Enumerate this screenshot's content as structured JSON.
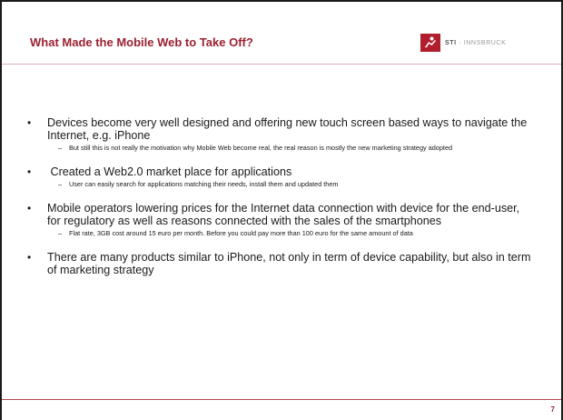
{
  "slide": {
    "title": "What Made the Mobile Web to Take Off?",
    "logo": {
      "mark": "sti-logo-icon",
      "text_bold": "STI",
      "text_rest": " · INNSBRUCK"
    },
    "bullets": [
      {
        "text": "Devices become very well designed and offering new touch screen based ways to navigate the Internet, e.g. iPhone",
        "sub": "But still this is not really the motivation why Mobile Web become real, the real reason is mostly the new marketing strategy adopted"
      },
      {
        "text": " Created a Web2.0 market place for applications",
        "sub": "User can easily search for applications matching their needs, install them and updated them"
      },
      {
        "text": "Mobile operators lowering prices for the Internet data connection with device for the end-user, for regulatory as well as reasons connected with the sales of the smartphones",
        "sub": "Flat rate, 3GB cost around 15 euro per month. Before you could pay more than 100 euro for the same amount of data"
      },
      {
        "text": "There are many products similar to iPhone, not only in term of device capability, but also in term of marketing strategy"
      }
    ],
    "page_number": "7",
    "colors": {
      "accent": "#9b2030",
      "logo": "#b01e2e"
    }
  }
}
